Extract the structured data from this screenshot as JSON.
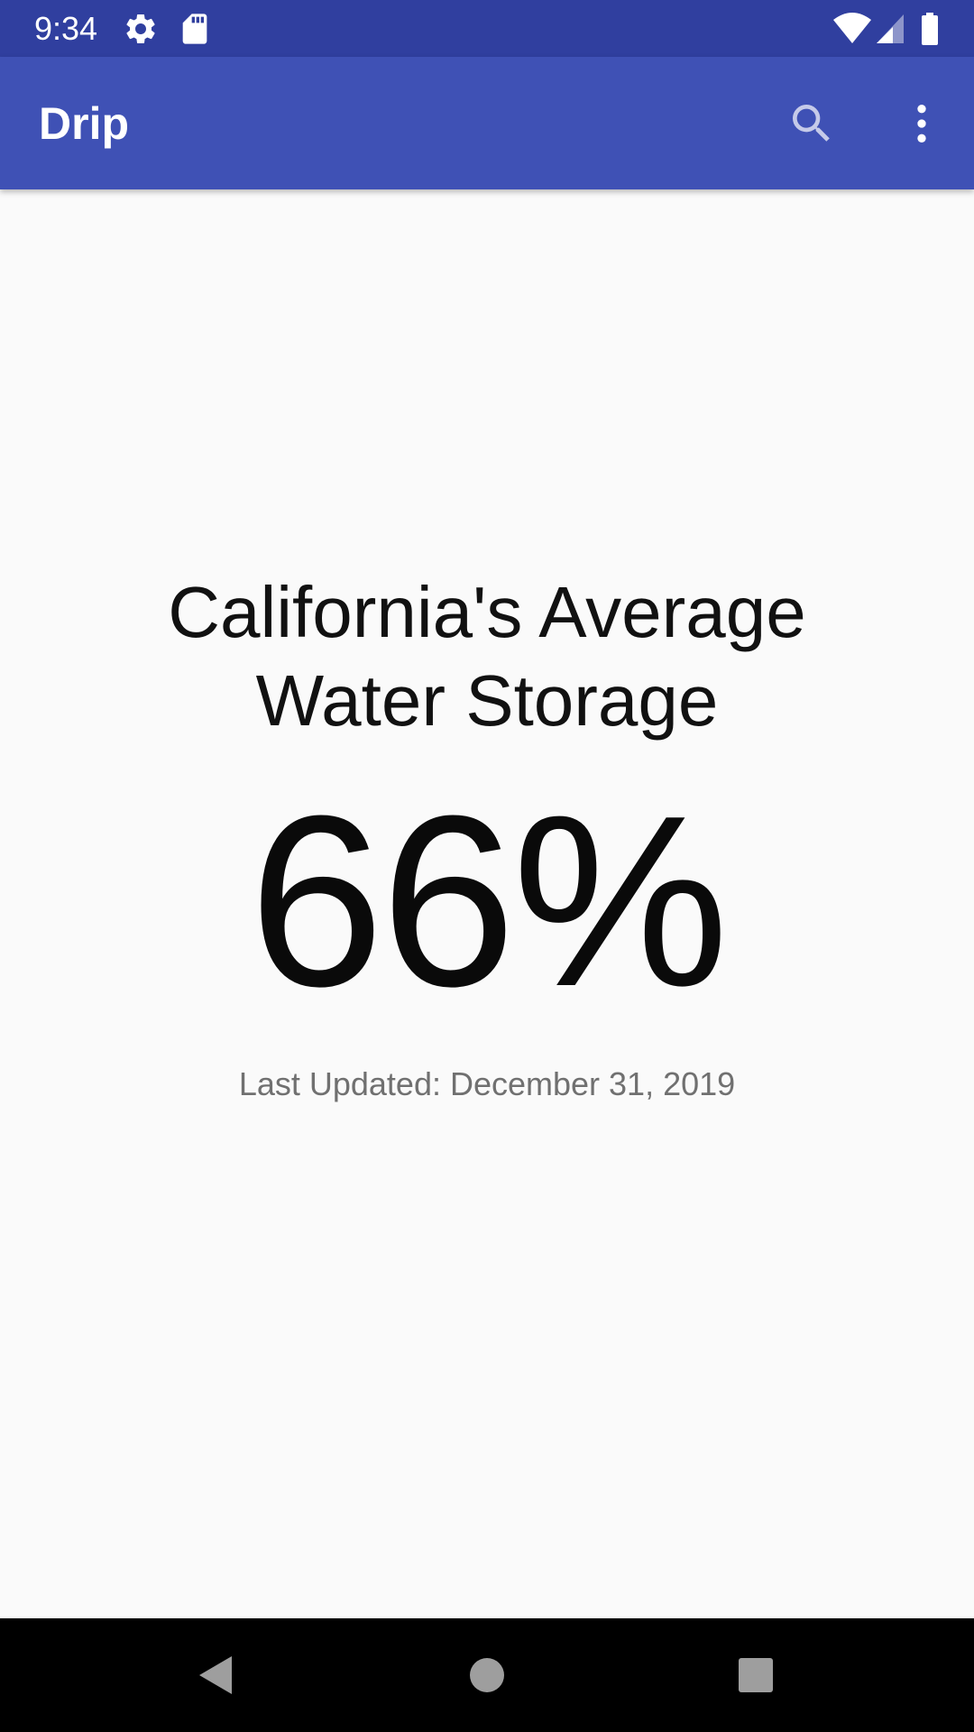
{
  "status_bar": {
    "time": "9:34",
    "icons": [
      "settings-icon",
      "sd-card-icon",
      "wifi-icon",
      "signal-icon",
      "battery-icon"
    ],
    "color": "#303f9f"
  },
  "app_bar": {
    "title": "Drip",
    "actions": [
      "search-icon",
      "more-vert-icon"
    ],
    "color": "#3f51b5"
  },
  "main": {
    "headline": "California's Average Water Storage",
    "value": "66%",
    "last_updated": "Last Updated: December 31, 2019"
  },
  "nav_bar": {
    "buttons": [
      "back-icon",
      "home-icon",
      "recents-icon"
    ]
  }
}
